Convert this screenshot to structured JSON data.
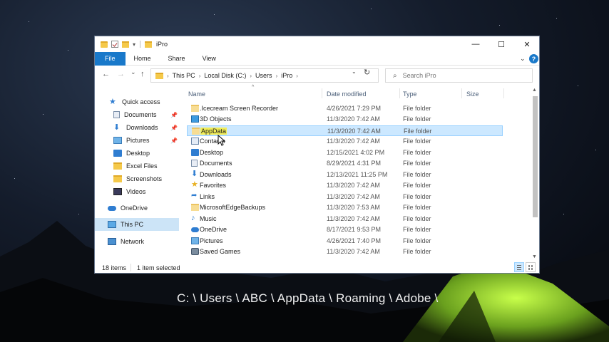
{
  "window": {
    "title": "iPro",
    "ribbon_tabs": [
      "File",
      "Home",
      "Share",
      "View"
    ],
    "controls": {
      "minimize": "—",
      "maximize": "☐",
      "close": "✕"
    }
  },
  "nav": {
    "back": "←",
    "forward": "→",
    "recent": "⌄",
    "up": "↑",
    "breadcrumb": [
      "This PC",
      "Local Disk (C:)",
      "Users",
      "iPro"
    ],
    "search_placeholder": "Search iPro"
  },
  "sidebar": {
    "items": [
      {
        "label": "Quick access",
        "icon": "star-icon",
        "pinned": false
      },
      {
        "label": "Documents",
        "icon": "documents-icon",
        "pinned": true
      },
      {
        "label": "Downloads",
        "icon": "downloads-icon",
        "pinned": true
      },
      {
        "label": "Pictures",
        "icon": "pictures-icon",
        "pinned": true
      },
      {
        "label": "Desktop",
        "icon": "desktop-icon",
        "pinned": false
      },
      {
        "label": "Excel Files",
        "icon": "folder-icon",
        "pinned": false
      },
      {
        "label": "Screenshots",
        "icon": "folder-icon",
        "pinned": false
      },
      {
        "label": "Videos",
        "icon": "videos-icon",
        "pinned": false
      },
      {
        "label": "OneDrive",
        "icon": "cloud-icon",
        "pinned": false
      },
      {
        "label": "This PC",
        "icon": "computer-icon",
        "pinned": false,
        "selected": true
      },
      {
        "label": "Network",
        "icon": "network-icon",
        "pinned": false
      }
    ]
  },
  "columns": {
    "name": "Name",
    "date": "Date modified",
    "type": "Type",
    "size": "Size"
  },
  "files": [
    {
      "name": ".Icecream Screen Recorder",
      "date": "4/26/2021 7:29 PM",
      "type": "File folder",
      "icon": "folder-icon"
    },
    {
      "name": "3D Objects",
      "date": "11/3/2020 7:42 AM",
      "type": "File folder",
      "icon": "3d-objects-icon"
    },
    {
      "name": "AppData",
      "date": "11/3/2020 7:42 AM",
      "type": "File folder",
      "icon": "folder-icon",
      "selected": true
    },
    {
      "name": "Contacts",
      "date": "11/3/2020 7:42 AM",
      "type": "File folder",
      "icon": "contacts-icon"
    },
    {
      "name": "Desktop",
      "date": "12/15/2021 4:02 PM",
      "type": "File folder",
      "icon": "desktop-icon"
    },
    {
      "name": "Documents",
      "date": "8/29/2021 4:31 PM",
      "type": "File folder",
      "icon": "documents-icon"
    },
    {
      "name": "Downloads",
      "date": "12/13/2021 11:25 PM",
      "type": "File folder",
      "icon": "downloads-icon"
    },
    {
      "name": "Favorites",
      "date": "11/3/2020 7:42 AM",
      "type": "File folder",
      "icon": "star-icon"
    },
    {
      "name": "Links",
      "date": "11/3/2020 7:42 AM",
      "type": "File folder",
      "icon": "links-icon"
    },
    {
      "name": "MicrosoftEdgeBackups",
      "date": "11/3/2020 7:53 AM",
      "type": "File folder",
      "icon": "folder-icon"
    },
    {
      "name": "Music",
      "date": "11/3/2020 7:42 AM",
      "type": "File folder",
      "icon": "music-icon"
    },
    {
      "name": "OneDrive",
      "date": "8/17/2021 9:53 PM",
      "type": "File folder",
      "icon": "cloud-icon"
    },
    {
      "name": "Pictures",
      "date": "4/26/2021 7:40 PM",
      "type": "File folder",
      "icon": "pictures-icon"
    },
    {
      "name": "Saved Games",
      "date": "11/3/2020 7:42 AM",
      "type": "File folder",
      "icon": "saved-games-icon"
    }
  ],
  "status": {
    "items": "18 items",
    "selection": "1 item selected"
  },
  "caption": "C: \\ Users \\ ABC \\ AppData \\ Roaming \\ Adobe \\"
}
